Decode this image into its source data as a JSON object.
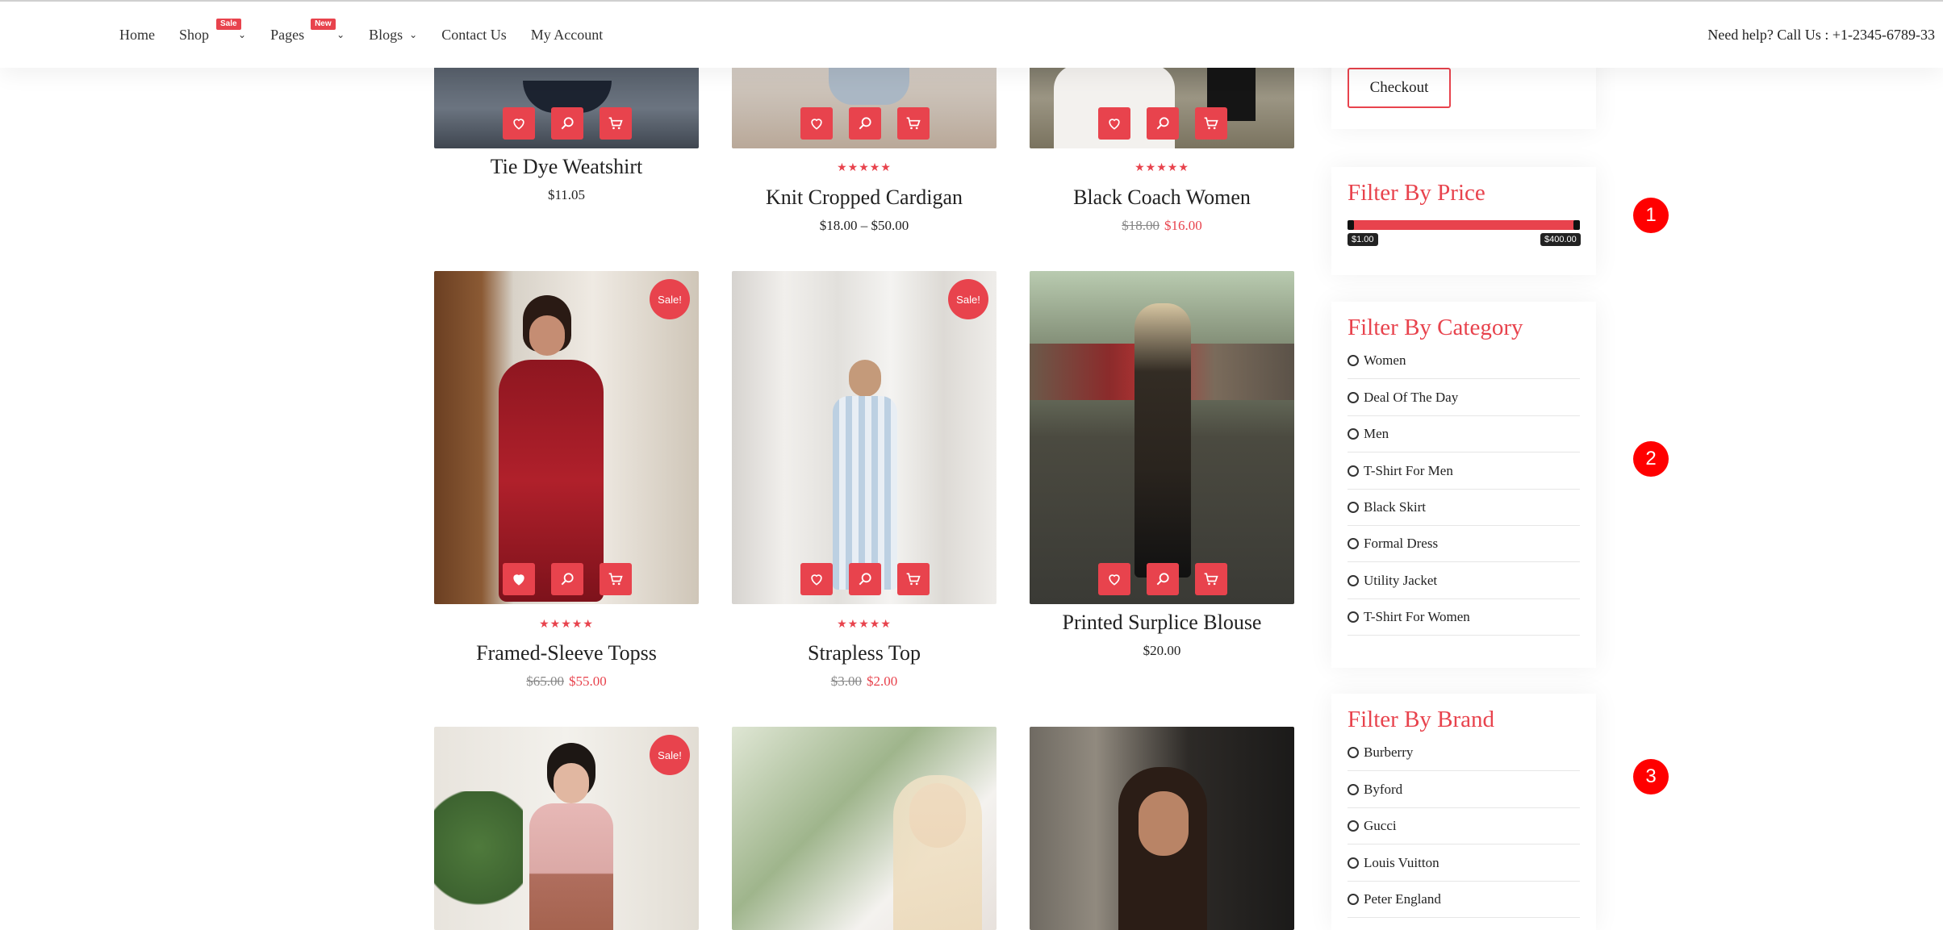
{
  "header": {
    "nav": [
      {
        "label": "Home",
        "badge": null,
        "dropdown": false
      },
      {
        "label": "Shop",
        "badge": "Sale",
        "dropdown": true
      },
      {
        "label": "Pages",
        "badge": "New",
        "dropdown": true
      },
      {
        "label": "Blogs",
        "badge": null,
        "dropdown": true
      },
      {
        "label": "Contact Us",
        "badge": null,
        "dropdown": false
      },
      {
        "label": "My Account",
        "badge": null,
        "dropdown": false
      }
    ],
    "help_text": "Need help? Call Us : +1-2345-6789-33"
  },
  "accent_color": "#e8434d",
  "products": [
    {
      "name": "Tie Dye Weatshirt",
      "rating": 0,
      "price": "$11.05",
      "old_price": "",
      "sale": false
    },
    {
      "name": "Knit Cropped Cardigan",
      "rating": 5,
      "price": "$18.00 – $50.00",
      "old_price": "",
      "sale": false
    },
    {
      "name": "Black Coach Women",
      "rating": 5,
      "price": "$16.00",
      "old_price": "$18.00",
      "sale": false
    },
    {
      "name": "Framed-Sleeve Topss",
      "rating": 5,
      "price": "$55.00",
      "old_price": "$65.00",
      "sale": true,
      "sale_label": "Sale!"
    },
    {
      "name": "Strapless Top",
      "rating": 5,
      "price": "$2.00",
      "old_price": "$3.00",
      "sale": true,
      "sale_label": "Sale!"
    },
    {
      "name": "Printed Surplice Blouse",
      "rating": 0,
      "price": "$20.00",
      "old_price": "",
      "sale": false
    },
    {
      "name": "",
      "sale": true,
      "sale_label": "Sale!"
    },
    {
      "name": "",
      "sale": false
    },
    {
      "name": "",
      "sale": false
    }
  ],
  "product_actions": [
    "heart-icon",
    "search-icon",
    "cart-icon"
  ],
  "cart": {
    "checkout_label": "Checkout"
  },
  "price_filter": {
    "title": "Filter By Price",
    "min_label": "$1.00",
    "max_label": "$400.00"
  },
  "category_filter": {
    "title": "Filter By Category",
    "options": [
      "Women",
      "Deal Of The Day",
      "Men",
      "T-Shirt For Men",
      "Black Skirt",
      "Formal Dress",
      "Utility Jacket",
      "T-Shirt For Women"
    ]
  },
  "brand_filter": {
    "title": "Filter By Brand",
    "options": [
      "Burberry",
      "Byford",
      "Gucci",
      "Louis Vuitton",
      "Peter England"
    ]
  },
  "markers": [
    "1",
    "2",
    "3"
  ]
}
